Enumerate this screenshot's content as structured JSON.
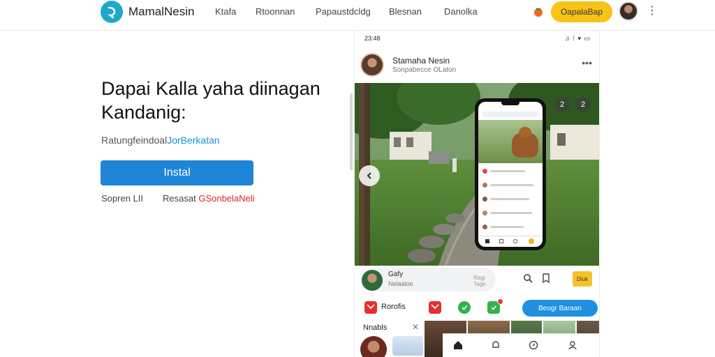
{
  "header": {
    "brand": "MamalNesin",
    "nav_links": [
      "Ktafa",
      "Rtoonnan",
      "Papaustdcldg",
      "Blesnan",
      "Danolka"
    ],
    "cta_label": "OapalaBap"
  },
  "hero": {
    "title": "Dapai Kalla yaha diinagan Kandanig:",
    "subtitle_plain": "Ratungfeindoal",
    "subtitle_highlight": "JorBerkatan",
    "install_label": "Instal",
    "meta_left": "Sopren LII",
    "meta_right_plain": "Resasat",
    "meta_right_red": "GSonbelaNeli"
  },
  "phone": {
    "status_time": "23:48",
    "status_icons": "♫ ⁞ ▾ ▭",
    "post": {
      "author": "Stamaha Nesin",
      "subline": "Sonpabecce OLaton",
      "more": "•••"
    },
    "photo_buttons": [
      "2",
      "2"
    ],
    "action_bar": {
      "name": "Gafy",
      "sub": "Nelaaloe",
      "tag": "Ragi\nTage",
      "badge": "Diuk"
    },
    "share": {
      "label": "Rorofis",
      "button": "Beogr Baraan"
    },
    "strip": {
      "label": "Nnabls",
      "close": "✕"
    }
  },
  "colors": {
    "brand_teal": "#1fa8c9",
    "install_blue": "#1f85d6",
    "cta_yellow": "#f7c316",
    "accent_red": "#d9262b",
    "share_blue": "#1f8fe0"
  },
  "icons": [
    "logo-icon",
    "tomato-icon",
    "more-vertical-icon",
    "chevron-left-icon",
    "search-icon",
    "bookmark-icon",
    "gmail-icon",
    "heart-icon",
    "whatsapp-icon",
    "home-icon",
    "bell-icon",
    "compass-icon",
    "person-icon"
  ]
}
